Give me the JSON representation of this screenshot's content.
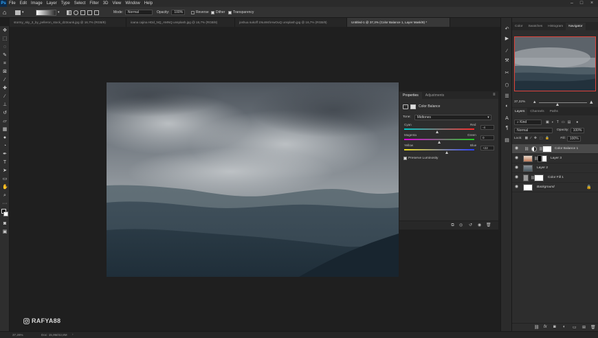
{
  "colors": {
    "accent_red": "#e0433a",
    "ps_blue": "#31a8ff",
    "halo": "#d6c428"
  },
  "menubar": {
    "app_icon": "Ps",
    "items": [
      "File",
      "Edit",
      "Image",
      "Layer",
      "Type",
      "Select",
      "Filter",
      "3D",
      "View",
      "Window",
      "Help"
    ]
  },
  "optbar": {
    "mode_label": "Mode:",
    "mode_value": "Normal",
    "opacity_label": "Opacity:",
    "opacity_value": "100%",
    "reverse_label": "Reverse",
    "dither_label": "Dither",
    "transparency_label": "Transparency"
  },
  "doctabs": [
    {
      "label": "stormy_sky_3_by_pelleron_stock_d23ounk.jpg @ 16,7% (RGB/8)",
      "active": false
    },
    {
      "label": "ioana cajina HDd_NQ_AMNQ unsplash.jpg @ 16,7% (RGB/8)",
      "active": false
    },
    {
      "label": "joshua sukoff 1NuW4hAwOuQ unsplash.jpg @ 16,7% (RGB/8)",
      "active": false
    },
    {
      "label": "Untitled-1 @ 37,3% (Color Balance 1, Layer Mask/8) *",
      "active": true
    }
  ],
  "properties": {
    "tab_properties": "Properties",
    "tab_adjustments": "Adjustments",
    "title": "Color Balance",
    "tone_label": "Tone:",
    "tone_value": "Midtones",
    "sliders": [
      {
        "left": "Cyan",
        "right": "Red",
        "value": "-4",
        "position": -4
      },
      {
        "left": "Magenta",
        "right": "Green",
        "value": "0",
        "position": 0
      },
      {
        "left": "Yellow",
        "right": "Blue",
        "value": "+22",
        "position": 22
      }
    ],
    "preserve_label": "Preserve Luminosity",
    "preserve_checked": true
  },
  "right_panels": {
    "top_tabs": [
      "Color",
      "Swatches",
      "Histogram",
      "Navigator"
    ],
    "active_top_tab": "Navigator",
    "zoom": "37,32%",
    "layer_tabs": [
      "Layers",
      "Channels",
      "Paths"
    ],
    "kind_filter": "Kind",
    "blend_mode": "Normal",
    "opacity_label": "Opacity:",
    "opacity_value": "100%",
    "lock_label": "Lock:",
    "fill_label": "Fill:",
    "fill_value": "100%",
    "layers": [
      {
        "name": "Color Balance 1",
        "selected": true
      },
      {
        "name": "Layer 3",
        "selected": false
      },
      {
        "name": "Layer 2",
        "selected": false
      },
      {
        "name": "Color Fill 1",
        "selected": false
      },
      {
        "name": "Background",
        "selected": false
      }
    ]
  },
  "status": {
    "zoom": "37,26%",
    "doc": "Doc: 15,9M/42,8M"
  },
  "watermark": {
    "handle": "RAFYA88"
  }
}
